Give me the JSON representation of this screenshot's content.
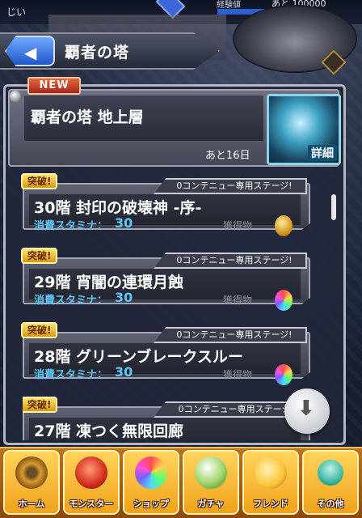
{
  "status": {
    "player_name": "じい",
    "exp_label": "経験値",
    "exp_remaining": "あと 100000"
  },
  "header": {
    "back_icon": "back-arrow-icon",
    "title": "覇者の塔"
  },
  "quest": {
    "badge": "NEW",
    "title": "覇者の塔 地上層",
    "days_left": "あと16日",
    "detail_label": "詳細"
  },
  "stages": [
    {
      "badge": "突破!",
      "tag": "0コンテニュー専用ステージ!",
      "title": "30階 封印の破壊神 -序-",
      "stamina_label": "消費スタミナ：",
      "stamina_value": "30",
      "reward_label": "獲得物",
      "reward_icon": "gold-egg-icon"
    },
    {
      "badge": "突破!",
      "tag": "0コンテニュー専用ステージ!",
      "title": "29階 宵闇の連環月蝕",
      "stamina_label": "消費スタミナ：",
      "stamina_value": "30",
      "reward_label": "獲得物",
      "reward_icon": "rainbow-orb-icon"
    },
    {
      "badge": "突破!",
      "tag": "0コンテニュー専用ステージ!",
      "title": "28階 グリーンブレークスルー",
      "stamina_label": "消費スタミナ：",
      "stamina_value": "30",
      "reward_label": "獲得物",
      "reward_icon": "rainbow-orb-icon"
    },
    {
      "badge": "突破!",
      "tag": "0コンテニュー専用ステージ",
      "title": "27階 凍つく無限回廊",
      "stamina_label": "",
      "stamina_value": "",
      "reward_label": "",
      "reward_icon": ""
    }
  ],
  "download_icon": "download-arrow-icon",
  "nav": [
    {
      "label": "ホーム",
      "icon": "home-icon"
    },
    {
      "label": "モンスター",
      "icon": "monster-icon"
    },
    {
      "label": "ショップ",
      "icon": "shop-orb-icon"
    },
    {
      "label": "ガチャ",
      "icon": "gacha-egg-icon"
    },
    {
      "label": "フレンド",
      "icon": "friend-icon"
    },
    {
      "label": "その他",
      "icon": "other-icon"
    }
  ],
  "colors": {
    "stamina_text": "#5ec8ff",
    "breakthrough_badge": "#f2c23a",
    "new_badge": "#c8402a",
    "nav_bar": "#f0a21c",
    "back_button": "#3f7fe8"
  }
}
